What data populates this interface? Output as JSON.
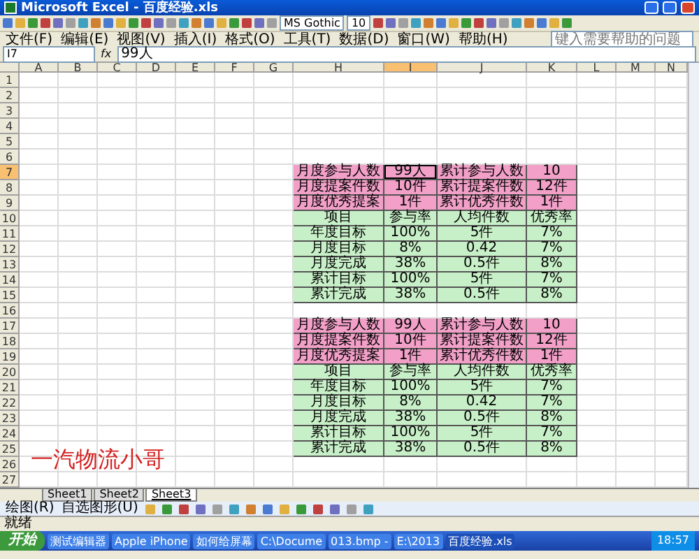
{
  "window": {
    "title": "Microsoft Excel - 百度经验.xls"
  },
  "toolbar": {
    "font": "MS Gothic",
    "size": "10"
  },
  "menu": [
    "文件(F)",
    "编辑(E)",
    "视图(V)",
    "插入(I)",
    "格式(O)",
    "工具(T)",
    "数据(D)",
    "窗口(W)",
    "帮助(H)"
  ],
  "help_box": {
    "placeholder": "键入需要帮助的问题"
  },
  "formula_bar": {
    "cell": "I7",
    "fx": "fx",
    "value": "99人"
  },
  "columns": [
    {
      "label": "A",
      "selected": false
    },
    {
      "label": "B",
      "selected": false
    },
    {
      "label": "C",
      "selected": false
    },
    {
      "label": "D",
      "selected": false
    },
    {
      "label": "E",
      "selected": false
    },
    {
      "label": "F",
      "selected": false
    },
    {
      "label": "G",
      "selected": false
    },
    {
      "label": "H",
      "selected": false
    },
    {
      "label": "I",
      "selected": true
    },
    {
      "label": "J",
      "selected": false
    },
    {
      "label": "K",
      "selected": false
    },
    {
      "label": "L",
      "selected": false
    },
    {
      "label": "M",
      "selected": false
    },
    {
      "label": "N",
      "selected": false
    }
  ],
  "rows": [
    {
      "header": "1",
      "selected": false
    },
    {
      "header": "2",
      "selected": false
    },
    {
      "header": "3",
      "selected": false
    },
    {
      "header": "4",
      "selected": false
    },
    {
      "header": "5",
      "selected": false
    },
    {
      "header": "6",
      "selected": false
    },
    {
      "header": "7",
      "selected": true,
      "cells": [
        {
          "text": "月度参与人数",
          "color": "#f2a0c8"
        },
        {
          "text": "99人",
          "color": "#f2a0c8",
          "selected": true
        },
        {
          "text": "累计参与人数",
          "color": "#f2a0c8"
        },
        {
          "text": "10",
          "color": "#f2a0c8"
        }
      ]
    },
    {
      "header": "8",
      "selected": false,
      "cells": [
        {
          "text": "月度提案件数",
          "color": "#f2a0c8"
        },
        {
          "text": "10件",
          "color": "#f2a0c8"
        },
        {
          "text": "累计提案件数",
          "color": "#f2a0c8"
        },
        {
          "text": "12件",
          "color": "#f2a0c8"
        }
      ]
    },
    {
      "header": "9",
      "selected": false,
      "cells": [
        {
          "text": "月度优秀提案",
          "color": "#f2a0c8"
        },
        {
          "text": "1件",
          "color": "#f2a0c8"
        },
        {
          "text": "累计优秀件数",
          "color": "#f2a0c8"
        },
        {
          "text": "1件",
          "color": "#f2a0c8"
        }
      ]
    },
    {
      "header": "10",
      "selected": false,
      "cells": [
        {
          "text": "项目",
          "color": "#c8f0c8"
        },
        {
          "text": "参与率",
          "color": "#c8f0c8"
        },
        {
          "text": "人均件数",
          "color": "#c8f0c8"
        },
        {
          "text": "优秀率",
          "color": "#c8f0c8"
        }
      ]
    },
    {
      "header": "11",
      "selected": false,
      "cells": [
        {
          "text": "年度目标",
          "color": "#c8f0c8"
        },
        {
          "text": "100%",
          "color": "#c8f0c8"
        },
        {
          "text": "5件",
          "color": "#c8f0c8"
        },
        {
          "text": "7%",
          "color": "#c8f0c8"
        }
      ]
    },
    {
      "header": "12",
      "selected": false,
      "cells": [
        {
          "text": "月度目标",
          "color": "#c8f0c8"
        },
        {
          "text": "8%",
          "color": "#c8f0c8"
        },
        {
          "text": "0.42",
          "color": "#c8f0c8"
        },
        {
          "text": "7%",
          "color": "#c8f0c8"
        }
      ]
    },
    {
      "header": "13",
      "selected": false,
      "cells": [
        {
          "text": "月度完成",
          "color": "#c8f0c8"
        },
        {
          "text": "38%",
          "color": "#c8f0c8"
        },
        {
          "text": "0.5件",
          "color": "#c8f0c8"
        },
        {
          "text": "8%",
          "color": "#c8f0c8"
        }
      ]
    },
    {
      "header": "14",
      "selected": false,
      "cells": [
        {
          "text": "累计目标",
          "color": "#c8f0c8"
        },
        {
          "text": "100%",
          "color": "#c8f0c8"
        },
        {
          "text": "5件",
          "color": "#c8f0c8"
        },
        {
          "text": "7%",
          "color": "#c8f0c8"
        }
      ]
    },
    {
      "header": "15",
      "selected": false,
      "cells": [
        {
          "text": "累计完成",
          "color": "#c8f0c8"
        },
        {
          "text": "38%",
          "color": "#c8f0c8"
        },
        {
          "text": "0.5件",
          "color": "#c8f0c8"
        },
        {
          "text": "8%",
          "color": "#c8f0c8"
        }
      ]
    },
    {
      "header": "16",
      "selected": false
    },
    {
      "header": "17",
      "selected": false,
      "cells": [
        {
          "text": "月度参与人数",
          "color": "#f2a0c8"
        },
        {
          "text": "99人",
          "color": "#f2a0c8"
        },
        {
          "text": "累计参与人数",
          "color": "#f2a0c8"
        },
        {
          "text": "10",
          "color": "#f2a0c8"
        }
      ]
    },
    {
      "header": "18",
      "selected": false,
      "cells": [
        {
          "text": "月度提案件数",
          "color": "#f2a0c8"
        },
        {
          "text": "10件",
          "color": "#f2a0c8"
        },
        {
          "text": "累计提案件数",
          "color": "#f2a0c8"
        },
        {
          "text": "12件",
          "color": "#f2a0c8"
        }
      ]
    },
    {
      "header": "19",
      "selected": false,
      "cells": [
        {
          "text": "月度优秀提案",
          "color": "#f2a0c8"
        },
        {
          "text": "1件",
          "color": "#f2a0c8"
        },
        {
          "text": "累计优秀件数",
          "color": "#f2a0c8"
        },
        {
          "text": "1件",
          "color": "#f2a0c8"
        }
      ]
    },
    {
      "header": "20",
      "selected": false,
      "cells": [
        {
          "text": "项目",
          "color": "#c8f0c8"
        },
        {
          "text": "参与率",
          "color": "#c8f0c8"
        },
        {
          "text": "人均件数",
          "color": "#c8f0c8"
        },
        {
          "text": "优秀率",
          "color": "#c8f0c8"
        }
      ]
    },
    {
      "header": "21",
      "selected": false,
      "cells": [
        {
          "text": "年度目标",
          "color": "#c8f0c8"
        },
        {
          "text": "100%",
          "color": "#c8f0c8"
        },
        {
          "text": "5件",
          "color": "#c8f0c8"
        },
        {
          "text": "7%",
          "color": "#c8f0c8"
        }
      ]
    },
    {
      "header": "22",
      "selected": false,
      "cells": [
        {
          "text": "月度目标",
          "color": "#c8f0c8"
        },
        {
          "text": "8%",
          "color": "#c8f0c8"
        },
        {
          "text": "0.42",
          "color": "#c8f0c8"
        },
        {
          "text": "7%",
          "color": "#c8f0c8"
        }
      ]
    },
    {
      "header": "23",
      "selected": false,
      "cells": [
        {
          "text": "月度完成",
          "color": "#c8f0c8"
        },
        {
          "text": "38%",
          "color": "#c8f0c8"
        },
        {
          "text": "0.5件",
          "color": "#c8f0c8"
        },
        {
          "text": "8%",
          "color": "#c8f0c8"
        }
      ]
    },
    {
      "header": "24",
      "selected": false,
      "cells": [
        {
          "text": "累计目标",
          "color": "#c8f0c8"
        },
        {
          "text": "100%",
          "color": "#c8f0c8"
        },
        {
          "text": "5件",
          "color": "#c8f0c8"
        },
        {
          "text": "7%",
          "color": "#c8f0c8"
        }
      ]
    },
    {
      "header": "25",
      "selected": false,
      "cells": [
        {
          "text": "累计完成",
          "color": "#c8f0c8"
        },
        {
          "text": "38%",
          "color": "#c8f0c8"
        },
        {
          "text": "0.5件",
          "color": "#c8f0c8"
        },
        {
          "text": "8%",
          "color": "#c8f0c8"
        }
      ]
    },
    {
      "header": "26",
      "selected": false
    },
    {
      "header": "27",
      "selected": false
    }
  ],
  "overlay_text": "一汽物流小哥",
  "sheet_tabs": [
    {
      "label": "Sheet1",
      "selected": false
    },
    {
      "label": "Sheet2",
      "selected": false
    },
    {
      "label": "Sheet3",
      "selected": true
    }
  ],
  "drawing_toolbar": [
    "绘图(R)",
    "自选图形(U)"
  ],
  "status_bar": "就绪",
  "taskbar": {
    "start": "开始",
    "items": [
      {
        "label": "测试编辑器",
        "selected": false
      },
      {
        "label": "Apple iPhone",
        "selected": false
      },
      {
        "label": "如何给屏幕",
        "selected": false
      },
      {
        "label": "C:\\Docume",
        "selected": false
      },
      {
        "label": "013.bmp -",
        "selected": false
      },
      {
        "label": "E:\\2013",
        "selected": false
      },
      {
        "label": "百度经验.xls",
        "selected": true
      }
    ],
    "clock": "18:57"
  }
}
